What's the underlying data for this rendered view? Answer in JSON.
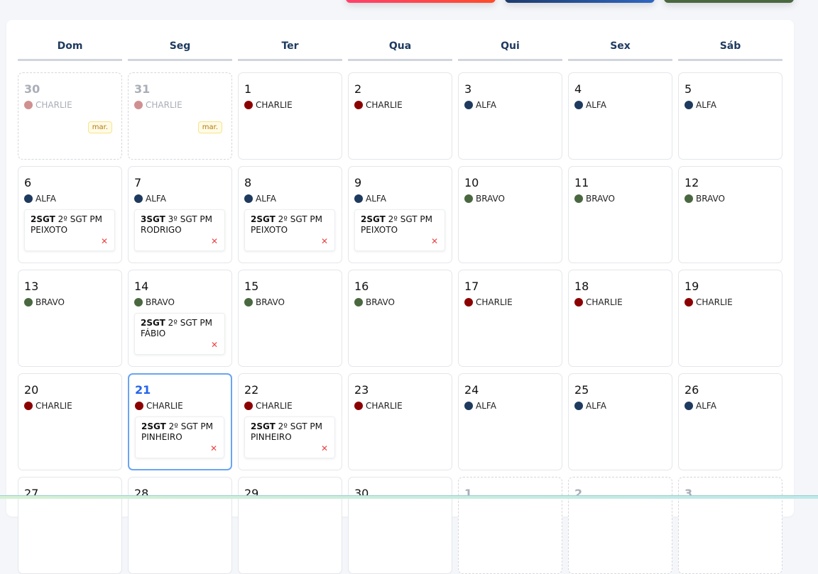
{
  "colors": {
    "ALFA": "#1e3a5f",
    "BRAVO": "#4a6840",
    "CHARLIE": "#8b0000",
    "CHARLIE_faded": "#d09090"
  },
  "weekdays": [
    "Dom",
    "Seg",
    "Ter",
    "Qua",
    "Qui",
    "Sex",
    "Sáb"
  ],
  "weeks": [
    [
      {
        "day": "30",
        "team": "CHARLIE",
        "other": true,
        "badge": "mar."
      },
      {
        "day": "31",
        "team": "CHARLIE",
        "other": true,
        "badge": "mar."
      },
      {
        "day": "1",
        "team": "CHARLIE"
      },
      {
        "day": "2",
        "team": "CHARLIE"
      },
      {
        "day": "3",
        "team": "ALFA"
      },
      {
        "day": "4",
        "team": "ALFA"
      },
      {
        "day": "5",
        "team": "ALFA"
      }
    ],
    [
      {
        "day": "6",
        "team": "ALFA",
        "person": {
          "rank": "2SGT",
          "name": "2º SGT PM PEIXOTO"
        }
      },
      {
        "day": "7",
        "team": "ALFA",
        "person": {
          "rank": "3SGT",
          "name": "3º SGT PM RODRIGO"
        }
      },
      {
        "day": "8",
        "team": "ALFA",
        "person": {
          "rank": "2SGT",
          "name": "2º SGT PM PEIXOTO"
        }
      },
      {
        "day": "9",
        "team": "ALFA",
        "person": {
          "rank": "2SGT",
          "name": "2º SGT PM PEIXOTO"
        }
      },
      {
        "day": "10",
        "team": "BRAVO"
      },
      {
        "day": "11",
        "team": "BRAVO"
      },
      {
        "day": "12",
        "team": "BRAVO"
      }
    ],
    [
      {
        "day": "13",
        "team": "BRAVO"
      },
      {
        "day": "14",
        "team": "BRAVO",
        "person": {
          "rank": "2SGT",
          "name": "2º SGT PM FÁBIO"
        }
      },
      {
        "day": "15",
        "team": "BRAVO"
      },
      {
        "day": "16",
        "team": "BRAVO"
      },
      {
        "day": "17",
        "team": "CHARLIE"
      },
      {
        "day": "18",
        "team": "CHARLIE"
      },
      {
        "day": "19",
        "team": "CHARLIE"
      }
    ],
    [
      {
        "day": "20",
        "team": "CHARLIE"
      },
      {
        "day": "21",
        "team": "CHARLIE",
        "today": true,
        "person": {
          "rank": "2SGT",
          "name": "2º SGT PM PINHEIRO"
        }
      },
      {
        "day": "22",
        "team": "CHARLIE",
        "person": {
          "rank": "2SGT",
          "name": "2º SGT PM PINHEIRO"
        }
      },
      {
        "day": "23",
        "team": "CHARLIE"
      },
      {
        "day": "24",
        "team": "ALFA"
      },
      {
        "day": "25",
        "team": "ALFA"
      },
      {
        "day": "26",
        "team": "ALFA"
      }
    ],
    [
      {
        "day": "27"
      },
      {
        "day": "28"
      },
      {
        "day": "29"
      },
      {
        "day": "30"
      },
      {
        "day": "1",
        "other": true
      },
      {
        "day": "2",
        "other": true
      },
      {
        "day": "3",
        "other": true
      }
    ]
  ],
  "remove_symbol": "✕"
}
